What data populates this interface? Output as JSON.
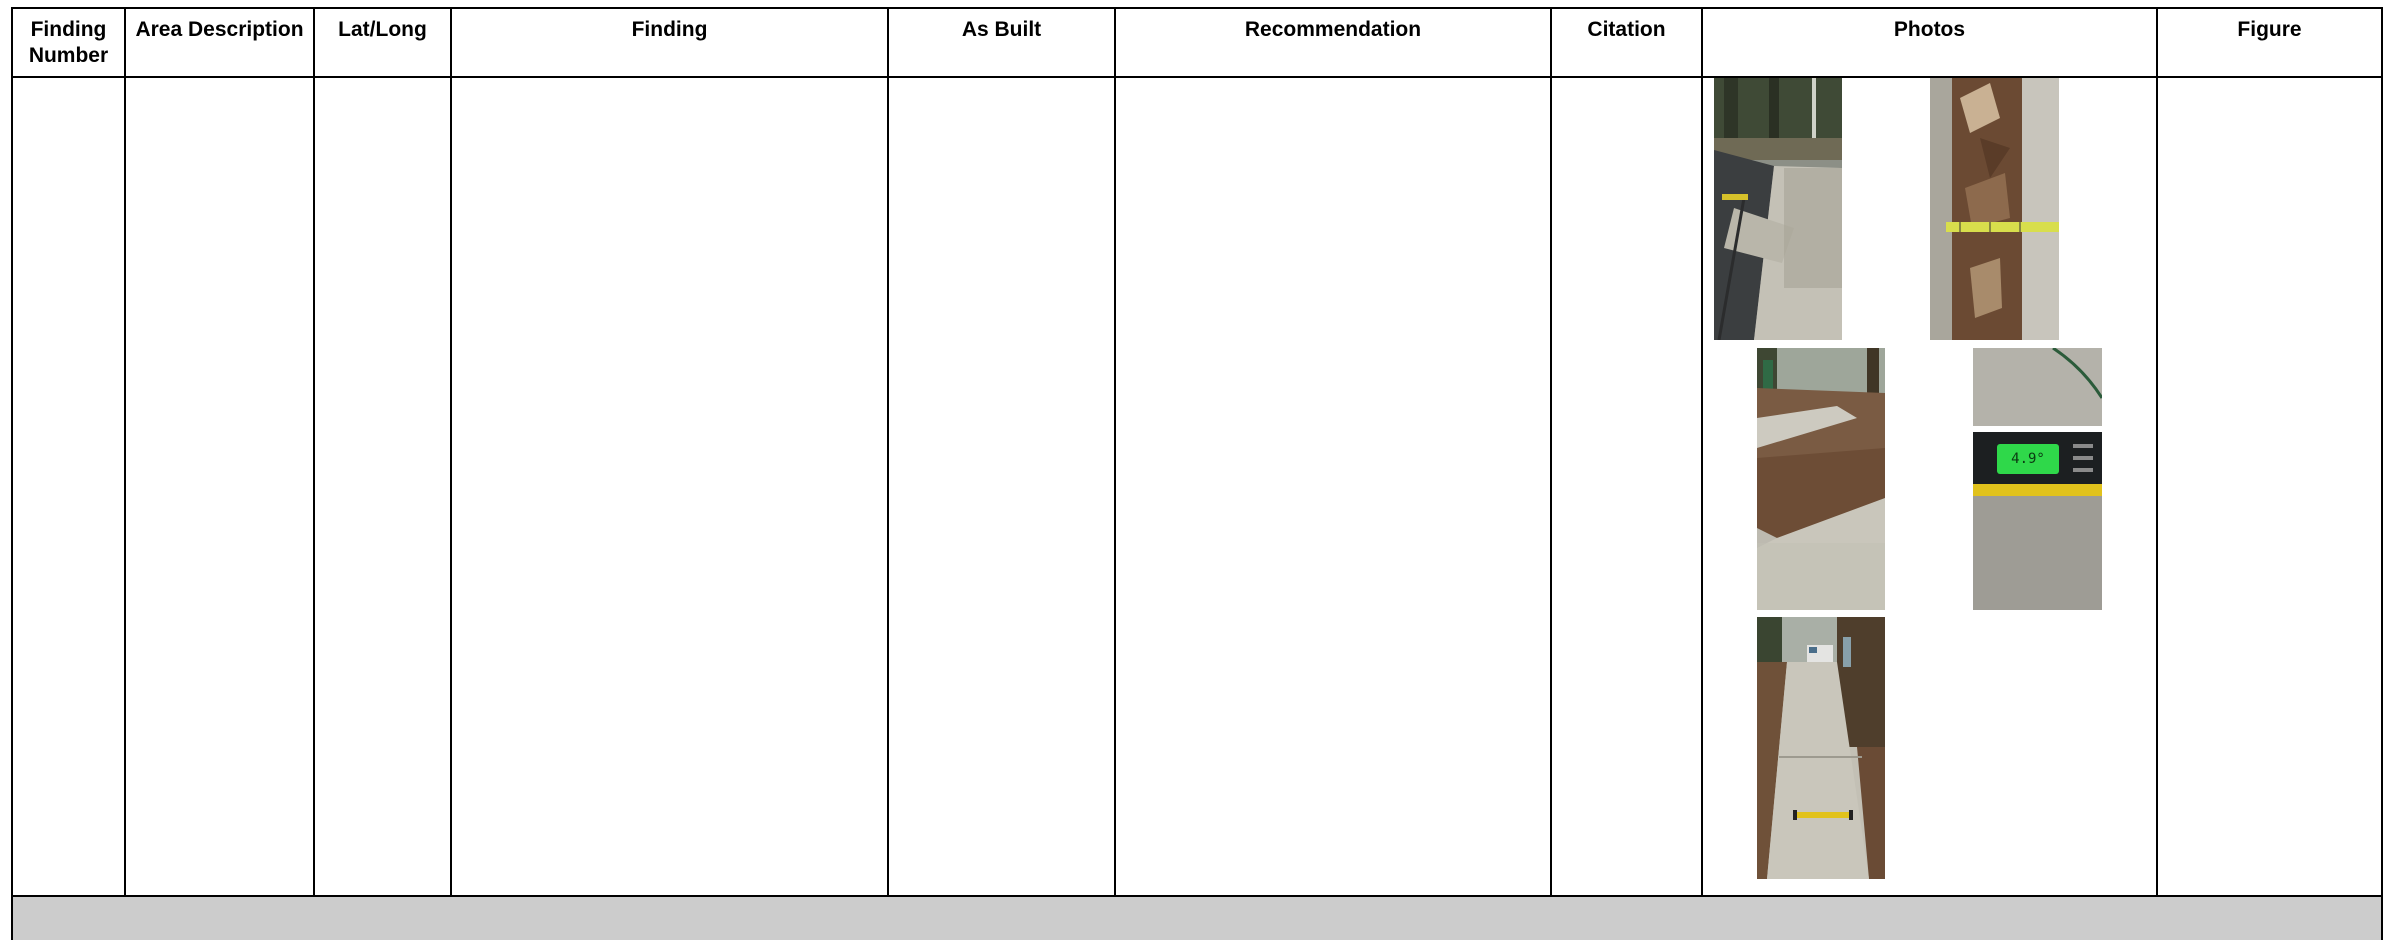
{
  "table": {
    "headers": {
      "finding_number": "Finding\nNumber",
      "area_description": "Area Description",
      "lat_long": "Lat/Long",
      "finding": "Finding",
      "as_built": "As Built",
      "recommendation": "Recommendation",
      "citation": "Citation",
      "photos": "Photos",
      "figure": "Figure"
    },
    "rows": [
      {
        "finding_number": "",
        "area_description": "",
        "lat_long": "",
        "finding": "",
        "as_built": "",
        "recommendation": "",
        "citation": "",
        "figure": "",
        "photos": [
          "sidewalk-crack-measuring-tape-photo",
          "expansion-joint-tape-measure-photo",
          "sidewalk-slope-level-photo",
          "digital-level-reading-photo",
          "sidewalk-running-slope-level-photo"
        ]
      }
    ]
  },
  "photo_readouts": {
    "digital_level_value": "4.9°"
  },
  "colors": {
    "border": "#000000",
    "footer_band": "#cccccc",
    "header_text": "#000000"
  }
}
